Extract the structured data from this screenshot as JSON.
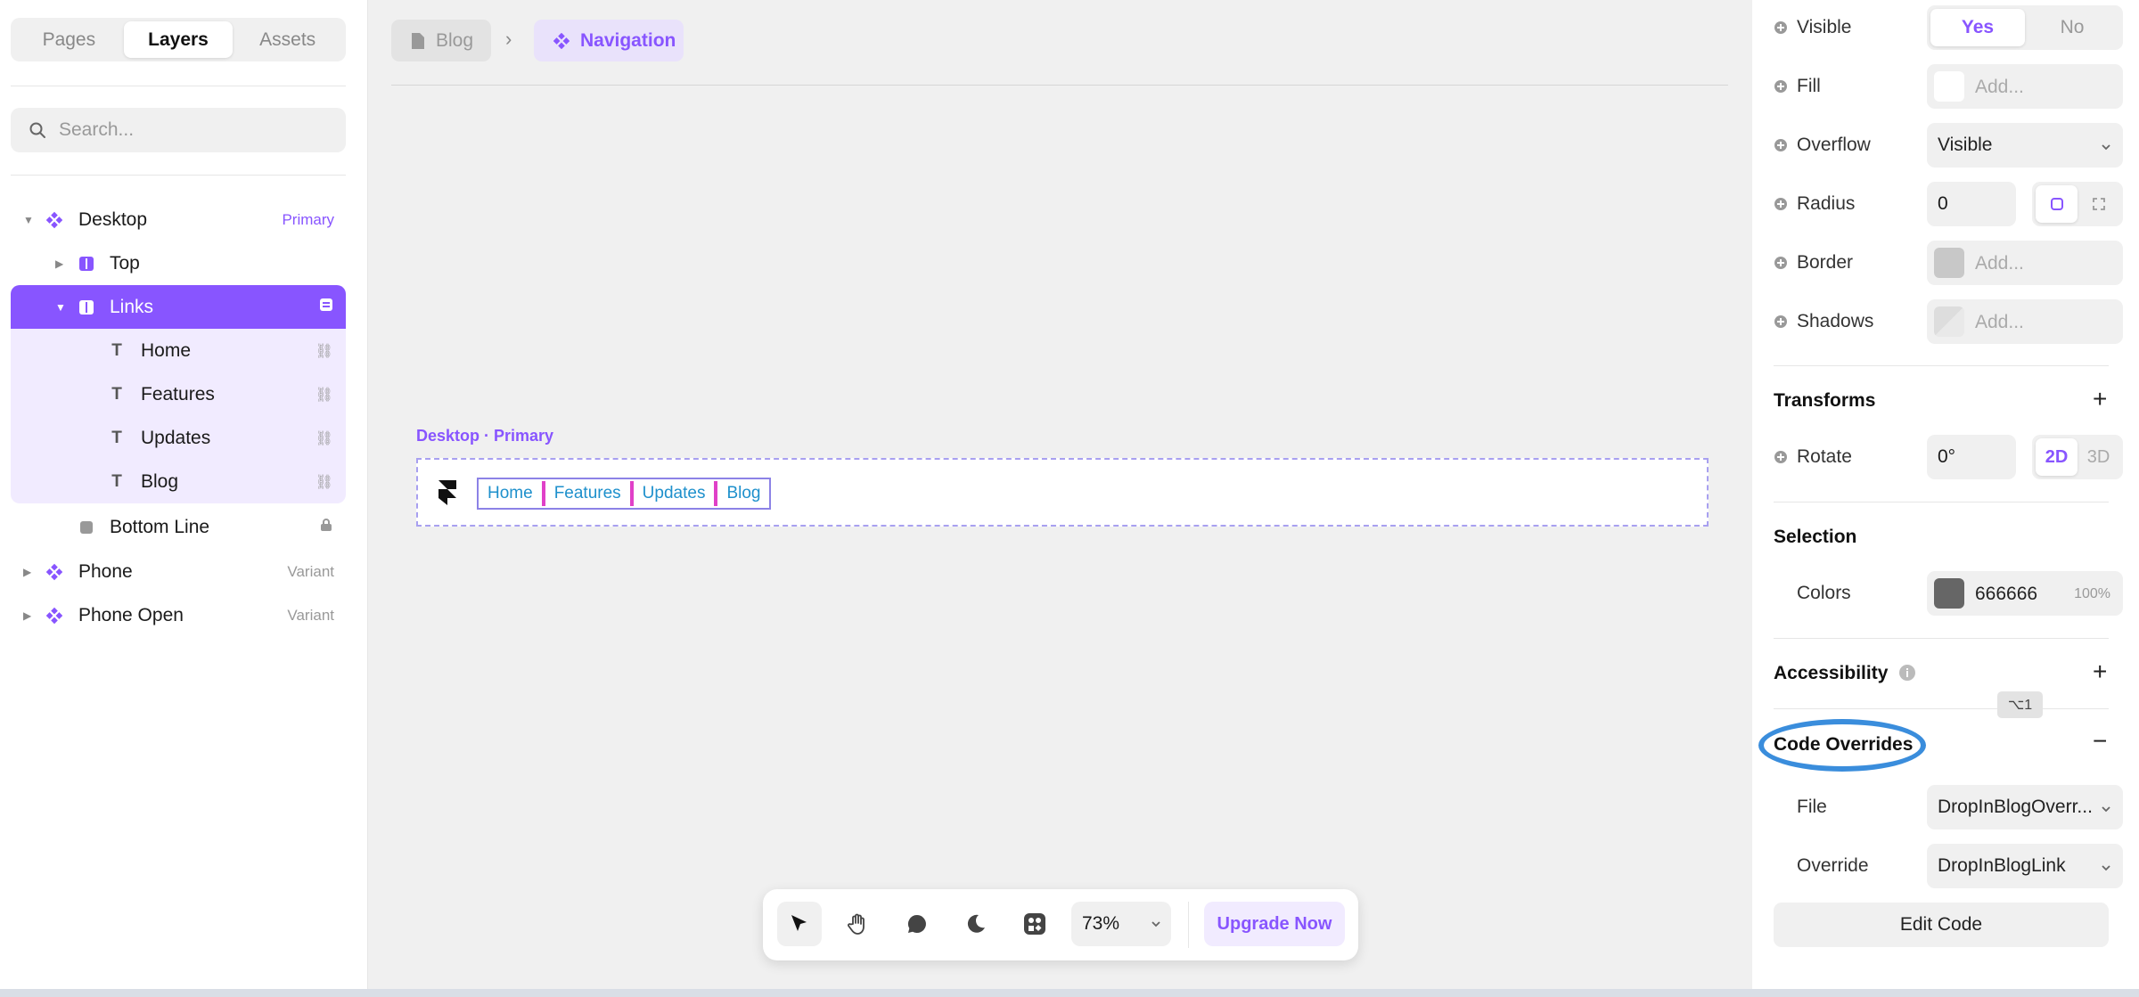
{
  "left_panel": {
    "tabs": [
      "Pages",
      "Layers",
      "Assets"
    ],
    "active_tab": "Layers",
    "search_placeholder": "Search...",
    "layers": [
      {
        "label": "Desktop",
        "badge": "Primary",
        "kind": "component"
      },
      {
        "label": "Top",
        "kind": "stack"
      },
      {
        "label": "Links",
        "kind": "stack",
        "selected": true
      },
      {
        "label": "Home",
        "kind": "text"
      },
      {
        "label": "Features",
        "kind": "text"
      },
      {
        "label": "Updates",
        "kind": "text"
      },
      {
        "label": "Blog",
        "kind": "text"
      },
      {
        "label": "Bottom Line",
        "kind": "rect"
      },
      {
        "label": "Phone",
        "badge": "Variant",
        "kind": "component"
      },
      {
        "label": "Phone Open",
        "badge": "Variant",
        "kind": "component"
      }
    ]
  },
  "canvas": {
    "breadcrumb": [
      "Blog",
      "Navigation"
    ],
    "frame_label": "Desktop · Primary",
    "nav_links": [
      "Home",
      "Features",
      "Updates",
      "Blog"
    ]
  },
  "toolbar": {
    "zoom": "73%",
    "upgrade_label": "Upgrade Now"
  },
  "right_panel": {
    "visible": {
      "label": "Visible",
      "yes": "Yes",
      "no": "No",
      "value": "Yes"
    },
    "fill": {
      "label": "Fill",
      "placeholder": "Add..."
    },
    "overflow": {
      "label": "Overflow",
      "value": "Visible"
    },
    "radius": {
      "label": "Radius",
      "value": "0"
    },
    "border": {
      "label": "Border",
      "placeholder": "Add..."
    },
    "shadows": {
      "label": "Shadows",
      "placeholder": "Add..."
    },
    "transforms": {
      "title": "Transforms"
    },
    "rotate": {
      "label": "Rotate",
      "value": "0°",
      "mode_2d": "2D",
      "mode_3d": "3D"
    },
    "selection": {
      "title": "Selection",
      "colors_label": "Colors",
      "color_hex": "666666",
      "opacity": "100%",
      "swatch": "#666666"
    },
    "accessibility": {
      "title": "Accessibility"
    },
    "shortcut": "⌥1",
    "code_overrides": {
      "title": "Code Overrides",
      "file_label": "File",
      "file_value": "DropInBlogOverr...",
      "override_label": "Override",
      "override_value": "DropInBlogLink",
      "edit_button": "Edit Code"
    }
  },
  "colors": {
    "accent": "#8855ff",
    "link": "#1e90cc",
    "highlight_ring": "#3a8ddc"
  }
}
